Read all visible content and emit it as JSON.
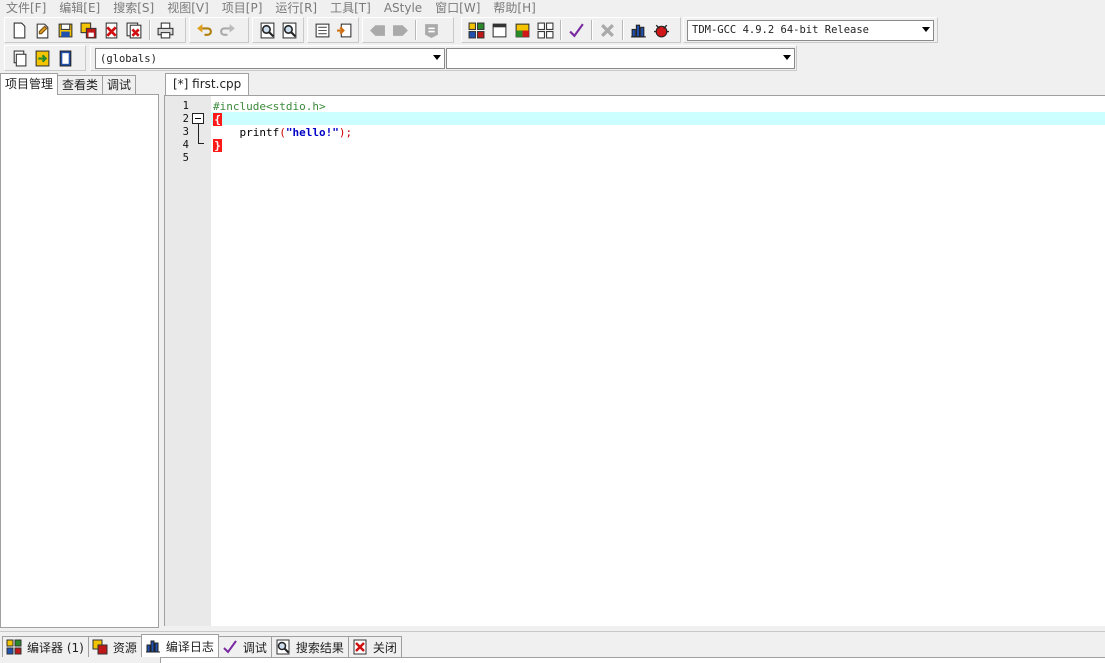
{
  "menu": [
    "文件[F]",
    "编辑[E]",
    "搜索[S]",
    "视图[V]",
    "项目[P]",
    "运行[R]",
    "工具[T]",
    "AStyle",
    "窗口[W]",
    "帮助[H]"
  ],
  "toolbar": {
    "icons": [
      "new-file-icon",
      "open-icon",
      "save-icon",
      "save-all-icon",
      "close-icon",
      "close-all-icon",
      "print-icon",
      "undo-icon",
      "redo-icon",
      "find-icon",
      "replace-icon",
      "goto-line-icon",
      "toggle-bookmark-icon",
      "back-icon",
      "forward-icon",
      "compile-icon",
      "new-project-icon",
      "window-icon",
      "layout-icon",
      "grid-icon",
      "check-icon",
      "stop-icon",
      "chart-icon",
      "debug-icon"
    ],
    "compiler_select": "TDM-GCC 4.9.2 64-bit Release"
  },
  "toolbar2": {
    "globals_select": "(globals)",
    "function_select": ""
  },
  "left_tabs": [
    "项目管理",
    "查看类",
    "调试"
  ],
  "editor": {
    "tab_label": "[*] first.cpp",
    "line_numbers": [
      "1",
      "2",
      "3",
      "4",
      "5"
    ],
    "code": {
      "line1": "#include<stdio.h>",
      "line2_brace": "{",
      "line3_indent": "    ",
      "line3_ident": "printf",
      "line3_open": "(",
      "line3_str": "\"hello!\"",
      "line3_close": ");",
      "line4_brace": "}"
    }
  },
  "bottom_tabs": [
    "编译器 (1)",
    "资源",
    "编译日志",
    "调试",
    "搜索结果",
    "关闭"
  ],
  "colors": {
    "current_line": "#ccffff",
    "brace_highlight": "#ff1a1a",
    "preprocessor": "#3a8a3a",
    "string": "#0000c8"
  }
}
